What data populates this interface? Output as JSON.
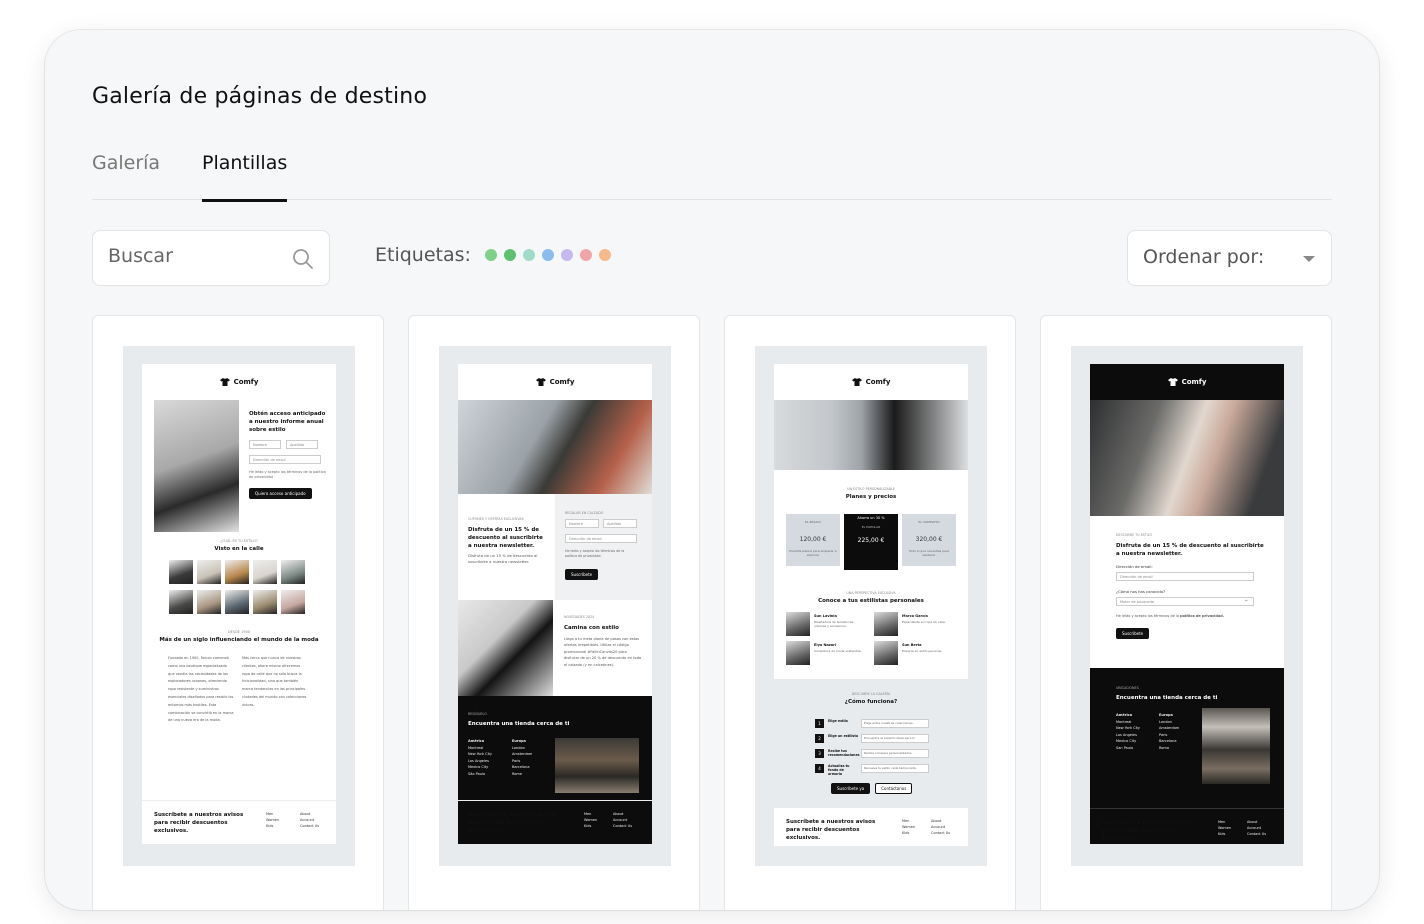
{
  "page": {
    "title": "Galería de páginas de destino"
  },
  "tabs": [
    {
      "label": "Galería",
      "active": false
    },
    {
      "label": "Plantillas",
      "active": true
    }
  ],
  "search": {
    "placeholder": "Buscar",
    "icon": "search-icon"
  },
  "tags": {
    "label": "Etiquetas:",
    "colors": [
      "#7fd08a",
      "#5cc272",
      "#9fdcc8",
      "#8cbcef",
      "#c7b8f2",
      "#f2a5a8",
      "#f5b98a"
    ]
  },
  "sort": {
    "label": "Ordenar por:"
  },
  "brand": "Comfy",
  "templates": [
    {
      "heading": "Obtén acceso anticipado a nuestro informe anual sobre estilo",
      "field_name": "Nombre",
      "field_last": "Apellido",
      "field_email": "Dirección de email",
      "consent": "He leído y acepto los términos de la política de privacidad",
      "button": "Quiero acceso anticipado",
      "kicker": "¿CUÁL ES TU ESTILO?",
      "gallery_title": "Visto en la calle",
      "kicker2": "DESDE 1900",
      "section_title": "Más de un siglo influenciando el mundo de la moda",
      "body1": "Fundada en 1900, Falcon comenzó como una boutique especializada que vendía las necesidades de los exploradores urbanos, ofreciendo ropa resistente y suministros esenciales diseñados para resistir los entornos más hostiles. Esta combinación se convirtió en la marca de una nueva era de la moda.",
      "body2": "Más cerca que nunca de nuestros clientes, ahora mismo ofrecemos ropa de calle que no solo busca la funcionalidad, sino que también marca tendencias en las principales ciudades del mundo con colecciones únicas.",
      "footer_text": "Suscríbete a nuestros avisos para recibir descuentos exclusivos.",
      "links_a": [
        "Men",
        "Women",
        "Kids"
      ],
      "links_b": [
        "About",
        "Account",
        "Contact Us"
      ]
    },
    {
      "kicker": "CUPONES Y OFERTAS EXCLUSIVAS",
      "heading": "Disfruta de un 15 % de descuento al suscribirte a nuestra newsletter.",
      "body": "Disfruta de un 15 % de descuento al suscribirte a nuestra newsletter.",
      "form_kicker": "REGALAR EN CALZADO",
      "field_name": "Nombre",
      "field_last": "Apellido",
      "field_email": "Dirección de email",
      "consent": "He leído y acepto los términos de la política de privacidad.",
      "button": "Suscríbete",
      "kicker2": "NOVEDADES 2024",
      "section_title": "Camina con estilo",
      "section_body": "Llega a tu meta diaria de pasos con estas ofertas irrepetibles. Utiliza el código promocional #FallInCanvas20 para disfrutar de un 20 % de descuento en todo el calzado (y en calcetines).",
      "stores_kicker": "RESÍGUELO",
      "stores_title": "Encuentra una tienda cerca de ti",
      "col_a": "América",
      "cities_a": [
        "Montreal",
        "New York City",
        "Los Angeles",
        "Mexico City",
        "São Paulo"
      ],
      "col_b": "Europa",
      "cities_b": [
        "London",
        "Amsterdam",
        "Paris",
        "Barcelona",
        "Rome"
      ],
      "footer_text": "Suscríbete a nuestros avisos para recibir descuentos exclusivos.",
      "links_a": [
        "Men",
        "Women",
        "Kids"
      ],
      "links_b": [
        "About",
        "Account",
        "Contact Us"
      ]
    },
    {
      "kicker": "UN ESTILO PERSONALIZABLE",
      "heading": "Planes y precios",
      "plans": [
        {
          "name": "EL BÁSICO",
          "price": "120,00 €",
          "note": "Plantilla básica para empezar a explorar"
        },
        {
          "name": "EL POPULAR",
          "price": "225,00 €",
          "badge": "Ahorra un 30 %"
        },
        {
          "name": "EL COMPLETO",
          "price": "320,00 €",
          "note": "Todo lo que necesitas para destacar"
        }
      ],
      "kicker2": "UNA PERSPECTIVA EXCLUSIVA",
      "stylists_title": "Conoce a tus estilistas personales",
      "stylists": [
        {
          "name": "Sun Lavinia",
          "desc": "Diseñadora de tendencias urbanas y accesorios."
        },
        {
          "name": "Marco García",
          "desc": "Especialista en ropa de calle."
        },
        {
          "name": "Elya Nazari",
          "desc": "Consultora de moda sostenible."
        },
        {
          "name": "Sun Berta",
          "desc": "Experta en estilo personal."
        }
      ],
      "kicker3": "DESCUBRE LA GALERÍA",
      "how_title": "¿Cómo funciona?",
      "steps": [
        {
          "n": "1",
          "title": "Elige estilo",
          "desc": "Elige entre nuestras colecciones."
        },
        {
          "n": "2",
          "title": "Elige un estilista",
          "desc": "Encuentra al experto ideal para ti."
        },
        {
          "n": "3",
          "title": "Recibe tus recomendaciones",
          "desc": "Recibe consejos personalizados."
        },
        {
          "n": "4",
          "title": "Actualiza tu fondo de armario",
          "desc": "Renueva tu estilo cada temporada."
        }
      ],
      "btn1": "Suscríbete ya",
      "btn2": "Contáctanos",
      "footer_text": "Suscríbete a nuestros avisos para recibir descuentos exclusivos.",
      "links_a": [
        "Men",
        "Women",
        "Kids"
      ],
      "links_b": [
        "About",
        "Account",
        "Contact Us"
      ]
    },
    {
      "kicker": "DESCUBRE TU ESTILO",
      "heading": "Disfruta de un 15 % de descuento al suscribirte a nuestra newsletter.",
      "email_label": "Dirección de email:",
      "email_ph": "Dirección de email",
      "select_label": "¿Cómo nos has conocido?",
      "select_value": "Motor de búsqueda",
      "consent_a": "He leído y acepto los términos de la",
      "consent_b": "política de privacidad.",
      "button": "Suscríbete",
      "stores_kicker": "UBICACIONES",
      "stores_title": "Encuentra una tienda cerca de ti",
      "col_a": "América",
      "cities_a": [
        "Montreal",
        "New York City",
        "Los Angeles",
        "Mexico City",
        "San Paulo"
      ],
      "col_b": "Europa",
      "cities_b": [
        "London",
        "Amsterdam",
        "Paris",
        "Barcelona",
        "Roma"
      ],
      "footer_text": "Suscríbete a nuestros avisos para recibir descuentos exclusivos.",
      "links_a": [
        "Men",
        "Women",
        "Kids"
      ],
      "links_b": [
        "About",
        "Account",
        "Contact Us"
      ]
    }
  ]
}
